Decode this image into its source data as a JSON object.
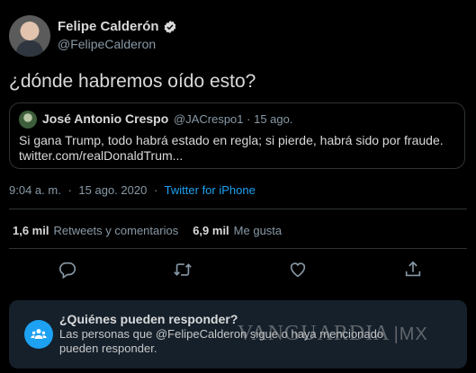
{
  "author": {
    "name": "Felipe Calderón",
    "handle": "@FelipeCalderon"
  },
  "tweet": {
    "text": "¿dónde habremos oído esto?",
    "time": "9:04 a. m.",
    "date": "15 ago. 2020",
    "separator": "·",
    "source": "Twitter for iPhone"
  },
  "quote": {
    "name": "José Antonio Crespo",
    "handle": "@JACrespo1",
    "separator": "·",
    "date": "15 ago.",
    "line1": "Si gana Trump, todo habrá estado en regla; si pierde, habrá sido por fraude.",
    "line2": "twitter.com/realDonaldTrum..."
  },
  "stats": {
    "retweets_count": "1,6 mil",
    "retweets_label": "Retweets y comentarios",
    "likes_count": "6,9 mil",
    "likes_label": "Me gusta"
  },
  "actions": [
    "reply-icon",
    "retweet-icon",
    "like-icon",
    "share-icon"
  ],
  "reply_panel": {
    "title": "¿Quiénes pueden responder?",
    "body": "Las personas que @FelipeCalderon sigue o haya mencionado pueden responder."
  },
  "watermark": {
    "brand": "VANGUARDIA",
    "suffix": "MX"
  },
  "colors": {
    "background": "#000000",
    "accent": "#1da1f2",
    "secondary_text": "#8899a6",
    "panel": "#15202b"
  }
}
